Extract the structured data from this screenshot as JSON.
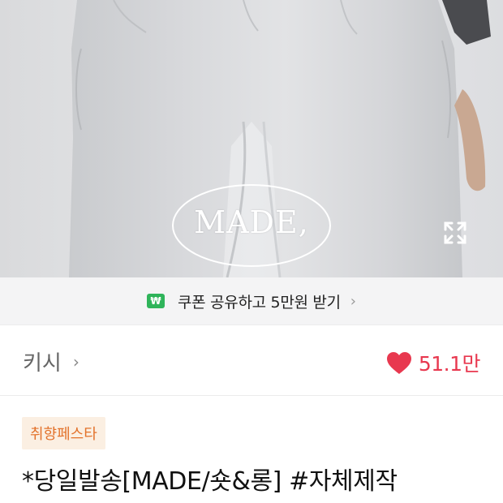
{
  "product_image": {
    "watermark": "MADE,",
    "expand_icon": "expand-arrows-icon"
  },
  "coupon": {
    "badge": "₩",
    "text": "쿠폰 공유하고 5만원 받기",
    "chevron": "›",
    "badge_color": "#2fb45a"
  },
  "store": {
    "name": "키시",
    "chevron": "›"
  },
  "likes": {
    "icon": "heart-icon",
    "count": "51.1만",
    "color": "#e8384f"
  },
  "tag": {
    "label": "취향페스타"
  },
  "product": {
    "title": "*당일발송[MADE/숏&롱] #자체제작"
  }
}
